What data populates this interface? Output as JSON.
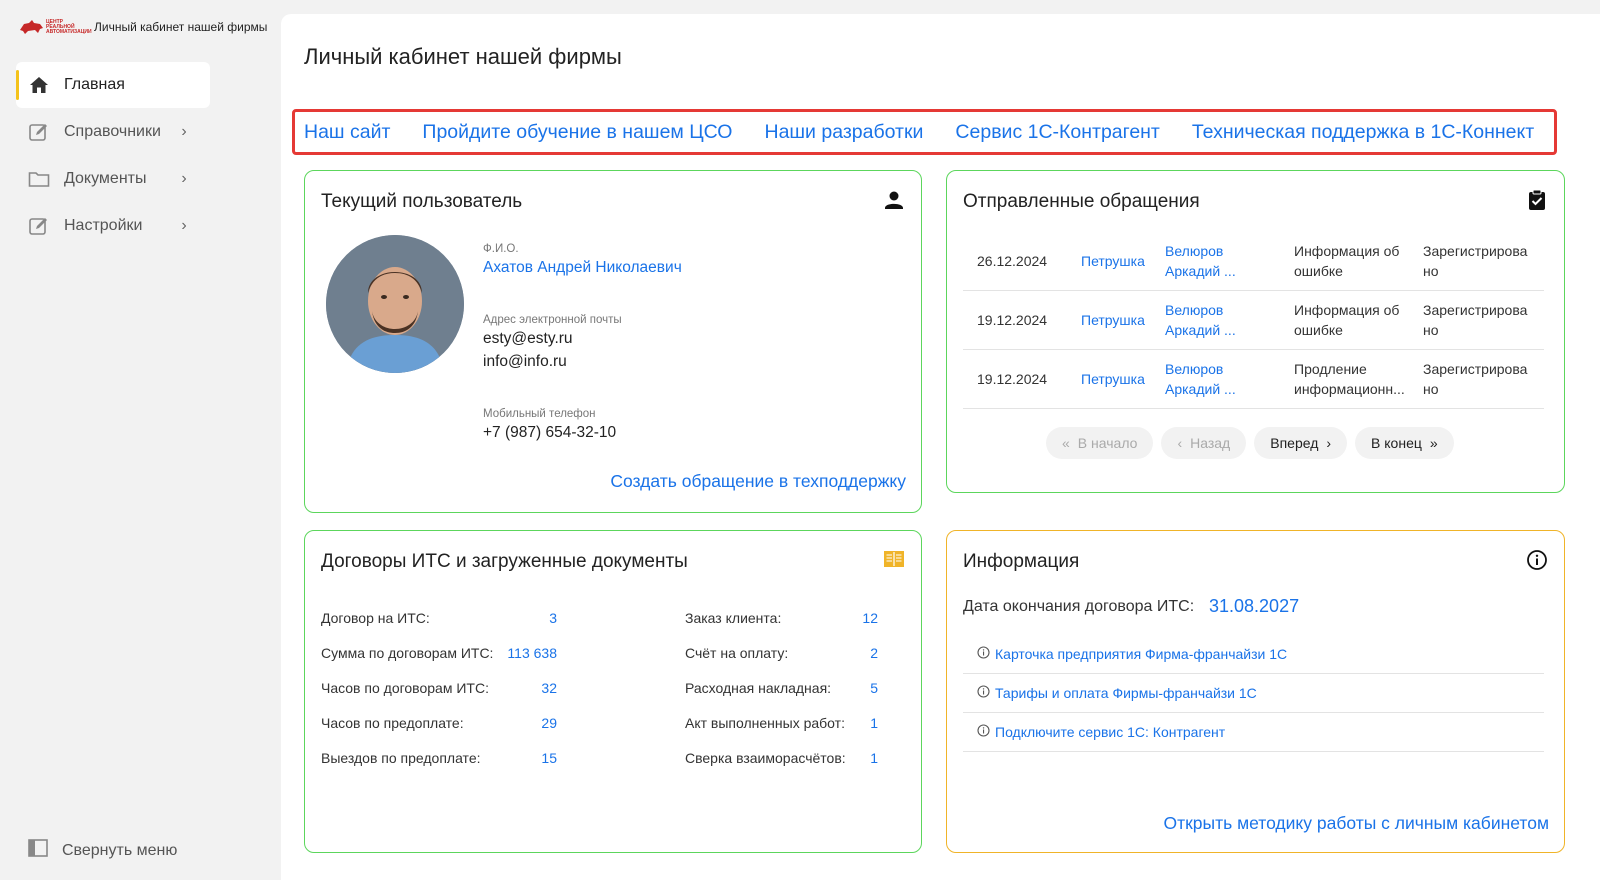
{
  "app": {
    "brand_title": "Личный кабинет нашей фирмы",
    "brand_logo_text": "ЦЕНТР РЕАЛЬНОЙ АВТОМАТИЗАЦИИ"
  },
  "sidebar": {
    "items": [
      {
        "label": "Главная",
        "icon": "home-icon"
      },
      {
        "label": "Справочники",
        "icon": "edit-icon"
      },
      {
        "label": "Документы",
        "icon": "folder-icon"
      },
      {
        "label": "Настройки",
        "icon": "edit-icon"
      }
    ],
    "collapse_label": "Свернуть меню"
  },
  "page": {
    "title": "Личный кабинет нашей фирмы"
  },
  "links": [
    "Наш сайт",
    "Пройдите обучение в нашем ЦСО",
    "Наши разработки",
    "Сервис 1С-Контрагент",
    "Техническая поддержка в 1С-Коннект"
  ],
  "user_card": {
    "title": "Текущий пользователь",
    "fio_label": "Ф.И.О.",
    "fio_value": "Ахатов Андрей Николаевич",
    "email_label": "Адрес электронной почты",
    "email_1": "esty@esty.ru",
    "email_2": "info@info.ru",
    "phone_label": "Мобильный телефон",
    "phone_value": "+7 (987) 654-32-10",
    "action": "Создать обращение в техподдержку"
  },
  "requests_card": {
    "title": "Отправленные обращения",
    "rows": [
      {
        "date": "26.12.2024",
        "author": "Петрушка",
        "exec_1": "Велюров",
        "exec_2": "Аркадий ...",
        "topic_1": "Информация об",
        "topic_2": "ошибке",
        "status_1": "Зарегистрирова",
        "status_2": "но"
      },
      {
        "date": "19.12.2024",
        "author": "Петрушка",
        "exec_1": "Велюров",
        "exec_2": "Аркадий ...",
        "topic_1": "Информация об",
        "topic_2": "ошибке",
        "status_1": "Зарегистрирова",
        "status_2": "но"
      },
      {
        "date": "19.12.2024",
        "author": "Петрушка",
        "exec_1": "Велюров",
        "exec_2": "Аркадий ...",
        "topic_1": "Продление",
        "topic_2": "информационн...",
        "status_1": "Зарегистрирова",
        "status_2": "но"
      }
    ],
    "pager": {
      "first": "В начало",
      "prev": "Назад",
      "next": "Вперед",
      "last": "В конец"
    }
  },
  "its_card": {
    "title": "Договоры ИТС и загруженные документы",
    "left": [
      {
        "label": "Договор на ИТС:",
        "value": "3"
      },
      {
        "label": "Сумма по договорам ИТС:",
        "value": "113 638"
      },
      {
        "label": "Часов по договорам ИТС:",
        "value": "32"
      },
      {
        "label": "Часов по предоплате:",
        "value": "29"
      },
      {
        "label": "Выездов по предоплате:",
        "value": "15"
      }
    ],
    "right": [
      {
        "label": "Заказ клиента:",
        "value": "12"
      },
      {
        "label": "Счёт на оплату:",
        "value": "2"
      },
      {
        "label": "Расходная накладная:",
        "value": "5"
      },
      {
        "label": "Акт выполненных работ:",
        "value": "1"
      },
      {
        "label": "Сверка взаиморасчётов:",
        "value": "1"
      }
    ]
  },
  "info_card": {
    "title": "Информация",
    "date_label": "Дата окончания договора ИТС:",
    "date_value": "31.08.2027",
    "items": [
      "Карточка предприятия Фирма-франчайзи 1С",
      "Тарифы и оплата Фирмы-франчайзи 1С",
      "Подключите сервис 1С: Контрагент"
    ],
    "action": "Открыть методику работы с личным кабинетом"
  },
  "colors": {
    "accent": "#1a73e8",
    "card_border": "#5cd65c",
    "info_border": "#f0b429",
    "links_border": "#e53935",
    "active_marker": "#f4c21a"
  }
}
